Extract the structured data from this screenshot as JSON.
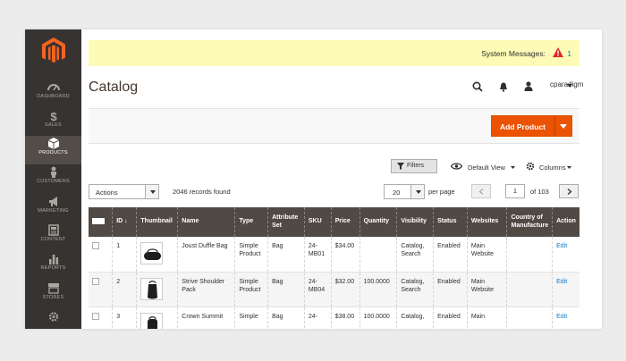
{
  "nav": [
    {
      "label": "DASHBOARD",
      "icon": "dashboard-icon"
    },
    {
      "label": "SALES",
      "icon": "dollar-icon"
    },
    {
      "label": "PRODUCTS",
      "icon": "cube-icon"
    },
    {
      "label": "CUSTOMERS",
      "icon": "person-icon"
    },
    {
      "label": "MARKETING",
      "icon": "megaphone-icon"
    },
    {
      "label": "CONTENT",
      "icon": "layout-icon"
    },
    {
      "label": "REPORTS",
      "icon": "bar-chart-icon"
    },
    {
      "label": "STORES",
      "icon": "storefront-icon"
    }
  ],
  "system_messages": {
    "label": "System Messages:",
    "count": "1"
  },
  "header": {
    "title": "Catalog",
    "user": "cparadigm"
  },
  "toolbar": {
    "add_product": "Add Product",
    "filters": "Filters",
    "default_view": "Default View",
    "columns": "Columns",
    "actions": "Actions",
    "records": "2046 records found",
    "per_page_value": "20",
    "per_page_label": "per page",
    "page": "1",
    "of_pages": "of 103"
  },
  "table": {
    "headers": [
      "ID",
      "Thumbnail",
      "Name",
      "Type",
      "Attribute Set",
      "SKU",
      "Price",
      "Quantity",
      "Visibility",
      "Status",
      "Websites",
      "Country of Manufacture",
      "Action"
    ],
    "rows": [
      {
        "id": "1",
        "name": "Joust Duffle Bag",
        "type": "Simple Product",
        "attr": "Bag",
        "sku": "24-MB01",
        "price": "$34.00",
        "qty": "",
        "visibility": "Catalog, Search",
        "status": "Enabled",
        "websites": "Main Website",
        "country": "",
        "action": "Edit"
      },
      {
        "id": "2",
        "name": "Strive Shoulder Pack",
        "type": "Simple Product",
        "attr": "Bag",
        "sku": "24-MB04",
        "price": "$32.00",
        "qty": "100.0000",
        "visibility": "Catalog, Search",
        "status": "Enabled",
        "websites": "Main Website",
        "country": "",
        "action": "Edit"
      },
      {
        "id": "3",
        "name": "Crown Summit",
        "type": "Simple",
        "attr": "Bag",
        "sku": "24-",
        "price": "$38.00",
        "qty": "100.0000",
        "visibility": "Catalog,",
        "status": "Enabled",
        "websites": "Main",
        "country": "",
        "action": "Edit"
      }
    ]
  },
  "colors": {
    "sidebar": "#373330",
    "accent": "#eb5202",
    "header_row": "#514943",
    "notice": "#fdfbb6",
    "link": "#1979c3"
  }
}
